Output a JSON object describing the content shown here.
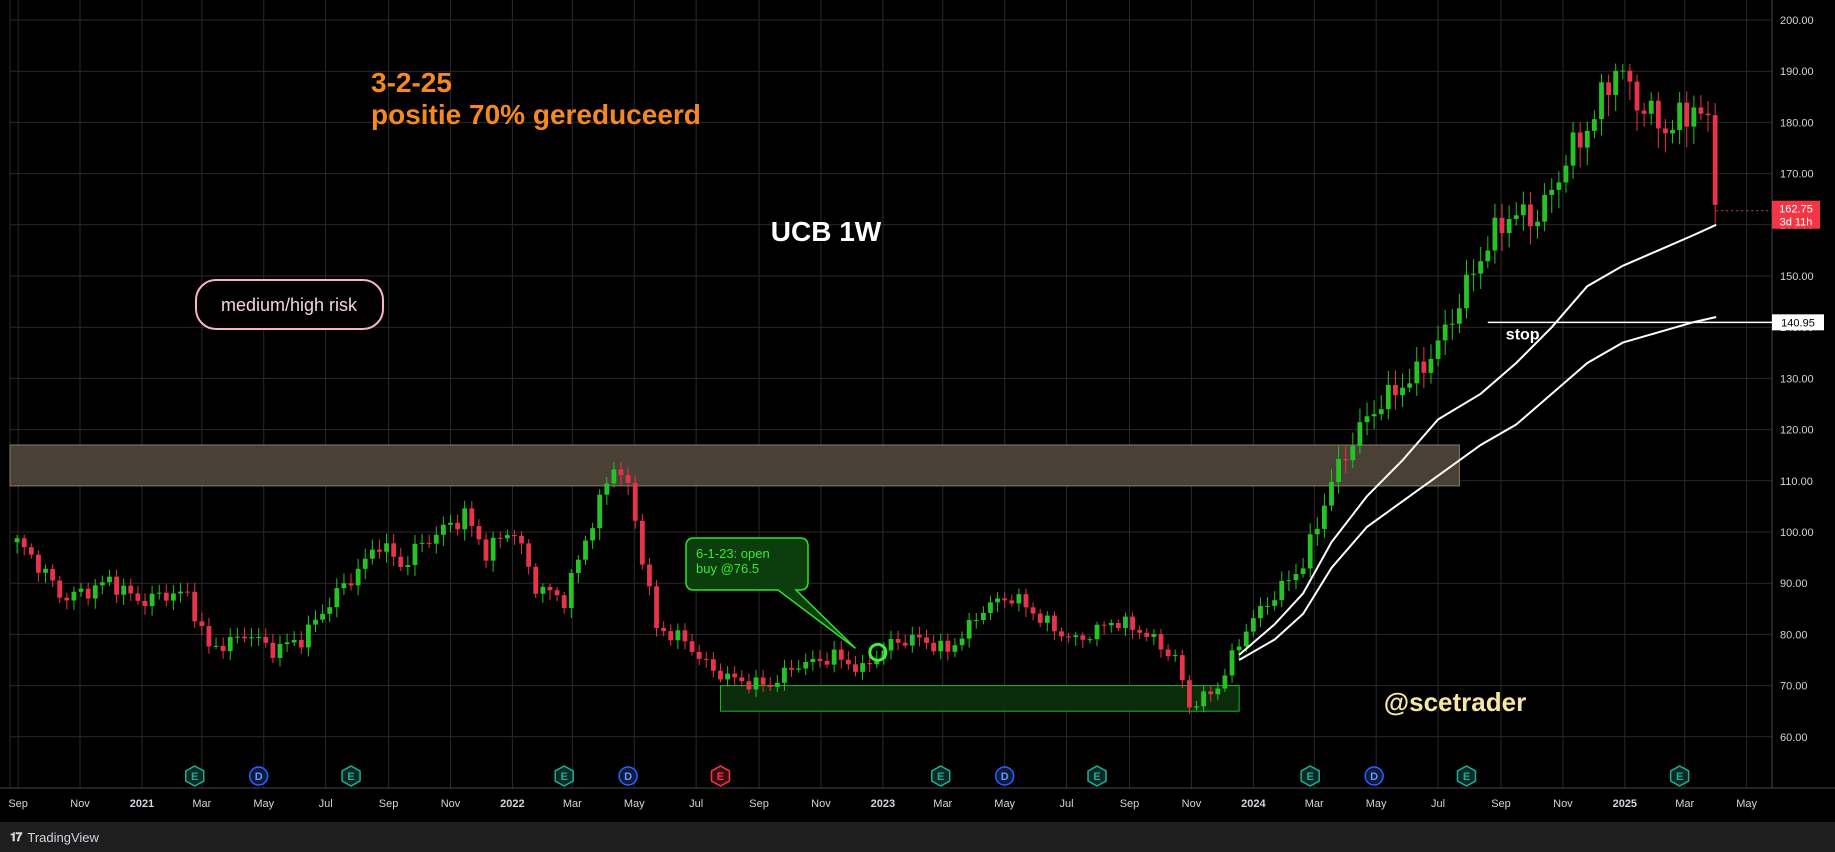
{
  "chart_data": {
    "type": "candlestick",
    "title": "UCB 1W",
    "ylim": [
      53,
      203
    ],
    "y_ticks": [
      60,
      70,
      80,
      90,
      100,
      110,
      120,
      130,
      140,
      150,
      160,
      170,
      180,
      190,
      200
    ],
    "x_tick_labels": [
      "Sep",
      "Nov",
      "2021",
      "Mar",
      "May",
      "Jul",
      "Sep",
      "Nov",
      "2022",
      "Mar",
      "May",
      "Jul",
      "Sep",
      "Nov",
      "2023",
      "Mar",
      "May",
      "Jul",
      "Sep",
      "Nov",
      "2024",
      "Mar",
      "May",
      "Jul",
      "Sep",
      "Nov",
      "2025",
      "Mar",
      "May"
    ],
    "close_path": [
      [
        "2020-08-31",
        98
      ],
      [
        "2020-10-15",
        86
      ],
      [
        "2020-11-30",
        92
      ],
      [
        "2021-01-01",
        86
      ],
      [
        "2021-02-15",
        87
      ],
      [
        "2021-03-08",
        78
      ],
      [
        "2021-04-15",
        81
      ],
      [
        "2021-05-10",
        76
      ],
      [
        "2021-06-07",
        78
      ],
      [
        "2021-07-15",
        90
      ],
      [
        "2021-08-23",
        98
      ],
      [
        "2021-09-13",
        92
      ],
      [
        "2021-10-11",
        98
      ],
      [
        "2021-11-15",
        105
      ],
      [
        "2021-12-06",
        97
      ],
      [
        "2022-01-01",
        100
      ],
      [
        "2022-01-24",
        88
      ],
      [
        "2022-02-21",
        87
      ],
      [
        "2022-03-14",
        100
      ],
      [
        "2022-04-11",
        114
      ],
      [
        "2022-04-25",
        108
      ],
      [
        "2022-05-23",
        80
      ],
      [
        "2022-06-20",
        79
      ],
      [
        "2022-07-18",
        74
      ],
      [
        "2022-08-22",
        70
      ],
      [
        "2022-09-12",
        69
      ],
      [
        "2022-10-10",
        74
      ],
      [
        "2022-11-14",
        77
      ],
      [
        "2022-12-12",
        73
      ],
      [
        "2023-01-09",
        77
      ],
      [
        "2023-02-06",
        79
      ],
      [
        "2023-03-06",
        78
      ],
      [
        "2023-04-10",
        85
      ],
      [
        "2023-05-08",
        86
      ],
      [
        "2023-06-05",
        83
      ],
      [
        "2023-07-10",
        80
      ],
      [
        "2023-08-14",
        82
      ],
      [
        "2023-09-18",
        79
      ],
      [
        "2023-10-16",
        76
      ],
      [
        "2023-10-30",
        67
      ],
      [
        "2023-11-27",
        70
      ],
      [
        "2023-12-25",
        80
      ],
      [
        "2024-01-22",
        87
      ],
      [
        "2024-02-19",
        95
      ],
      [
        "2024-03-18",
        111
      ],
      [
        "2024-04-15",
        119
      ],
      [
        "2024-05-13",
        125
      ],
      [
        "2024-06-10",
        132
      ],
      [
        "2024-07-08",
        141
      ],
      [
        "2024-08-05",
        150
      ],
      [
        "2024-09-09",
        160
      ],
      [
        "2024-10-07",
        163
      ],
      [
        "2024-11-04",
        175
      ],
      [
        "2024-12-02",
        180
      ],
      [
        "2024-12-23",
        188
      ],
      [
        "2025-01-13",
        183
      ],
      [
        "2025-02-10",
        181
      ],
      [
        "2025-03-10",
        185
      ],
      [
        "2025-03-24",
        179
      ],
      [
        "2025-04-01",
        163
      ]
    ],
    "ma_fast": [
      [
        "2023-12-18",
        76
      ],
      [
        "2024-01-22",
        82
      ],
      [
        "2024-02-19",
        88
      ],
      [
        "2024-03-18",
        98
      ],
      [
        "2024-04-22",
        107
      ],
      [
        "2024-05-27",
        114
      ],
      [
        "2024-07-01",
        122
      ],
      [
        "2024-08-12",
        127
      ],
      [
        "2024-09-16",
        133
      ],
      [
        "2024-10-21",
        140
      ],
      [
        "2024-11-25",
        148
      ],
      [
        "2024-12-30",
        152
      ],
      [
        "2025-02-03",
        155
      ],
      [
        "2025-03-10",
        158
      ],
      [
        "2025-04-01",
        160
      ]
    ],
    "ma_slow": [
      [
        "2023-12-18",
        75
      ],
      [
        "2024-01-22",
        79
      ],
      [
        "2024-02-19",
        84
      ],
      [
        "2024-03-18",
        93
      ],
      [
        "2024-04-22",
        101
      ],
      [
        "2024-05-27",
        106
      ],
      [
        "2024-07-01",
        111
      ],
      [
        "2024-08-12",
        117
      ],
      [
        "2024-09-16",
        121
      ],
      [
        "2024-10-21",
        127
      ],
      [
        "2024-11-25",
        133
      ],
      [
        "2024-12-30",
        137
      ],
      [
        "2025-02-03",
        139
      ],
      [
        "2025-03-10",
        141
      ],
      [
        "2025-04-01",
        142
      ]
    ],
    "zones": [
      {
        "name": "resistance-zone",
        "x0": "2020-08-24",
        "x1": "2024-07-22",
        "y0": 109,
        "y1": 117,
        "fill": "#4d4539",
        "stroke": "#8a7a64"
      },
      {
        "name": "support-zone",
        "x0": "2022-07-25",
        "x1": "2023-12-18",
        "y0": 65,
        "y1": 70,
        "fill": "#0c2e0c",
        "stroke": "#1fb51f"
      }
    ],
    "stop_level": {
      "value": 140.95,
      "label": "140.95",
      "x0": "2024-08-19",
      "note": "stop"
    },
    "last_price": {
      "value": 162.75,
      "label": "162.75",
      "timer": "3d 11h",
      "color": "#f23645"
    },
    "entry_marker": {
      "date": "2022-12-27",
      "value": 76.5
    },
    "callout": {
      "line1": "6-1-23: open",
      "line2": "buy @76.5",
      "target_date": "2022-12-05",
      "target_value": 76.5
    },
    "events": [
      {
        "date": "2021-02-22",
        "label": "E",
        "type": "earnings"
      },
      {
        "date": "2021-04-26",
        "label": "D",
        "type": "dividend"
      },
      {
        "date": "2021-07-26",
        "label": "E",
        "type": "earnings"
      },
      {
        "date": "2022-02-21",
        "label": "E",
        "type": "earnings"
      },
      {
        "date": "2022-04-25",
        "label": "D",
        "type": "dividend"
      },
      {
        "date": "2022-07-25",
        "label": "E",
        "type": "earnings-miss"
      },
      {
        "date": "2023-02-27",
        "label": "E",
        "type": "earnings"
      },
      {
        "date": "2023-05-01",
        "label": "D",
        "type": "dividend"
      },
      {
        "date": "2023-07-31",
        "label": "E",
        "type": "earnings"
      },
      {
        "date": "2024-02-26",
        "label": "E",
        "type": "earnings"
      },
      {
        "date": "2024-04-29",
        "label": "D",
        "type": "dividend"
      },
      {
        "date": "2024-07-29",
        "label": "E",
        "type": "earnings"
      },
      {
        "date": "2025-02-24",
        "label": "E",
        "type": "earnings"
      }
    ],
    "annotations": {
      "date_note": "3-2-25",
      "position_note": "positie 70% gereduceerd",
      "risk_note": "medium/high risk",
      "author": "@scetrader"
    },
    "colors": {
      "up": "#26c226",
      "down": "#e8344a",
      "grid": "#2a2a2a",
      "ma": "#ffffff",
      "note": "#f5891f",
      "author": "#f6e7a3",
      "risk_border": "#f8b4c4"
    }
  },
  "footer": {
    "brand": "TradingView"
  }
}
